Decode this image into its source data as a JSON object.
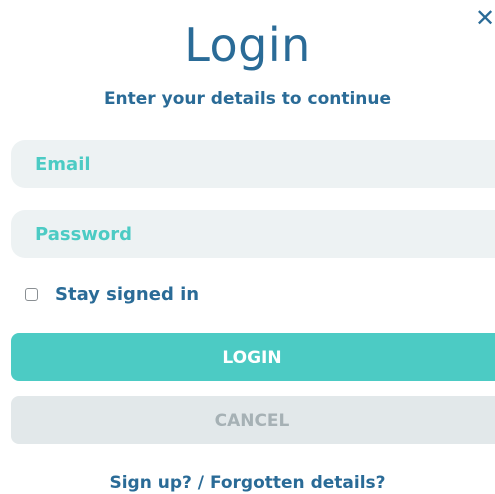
{
  "dialog": {
    "close_glyph": "✕",
    "title": "Login",
    "subtitle": "Enter your details to continue"
  },
  "form": {
    "email_placeholder": "Email",
    "password_placeholder": "Password",
    "remember_label": "Stay signed in",
    "remember_checked": false
  },
  "buttons": {
    "login_label": "LOGIN",
    "cancel_label": "CANCEL"
  },
  "footer": {
    "signup_label": "Sign up?",
    "separator": " / ",
    "forgot_label": "Forgotten details?"
  },
  "colors": {
    "primary_text": "#2a6b97",
    "accent": "#4ccbc4",
    "field_bg": "#edf2f3",
    "cancel_bg": "#e2e8ea",
    "cancel_text": "#a6b1b5"
  },
  "icons": {
    "close": "close-icon"
  }
}
